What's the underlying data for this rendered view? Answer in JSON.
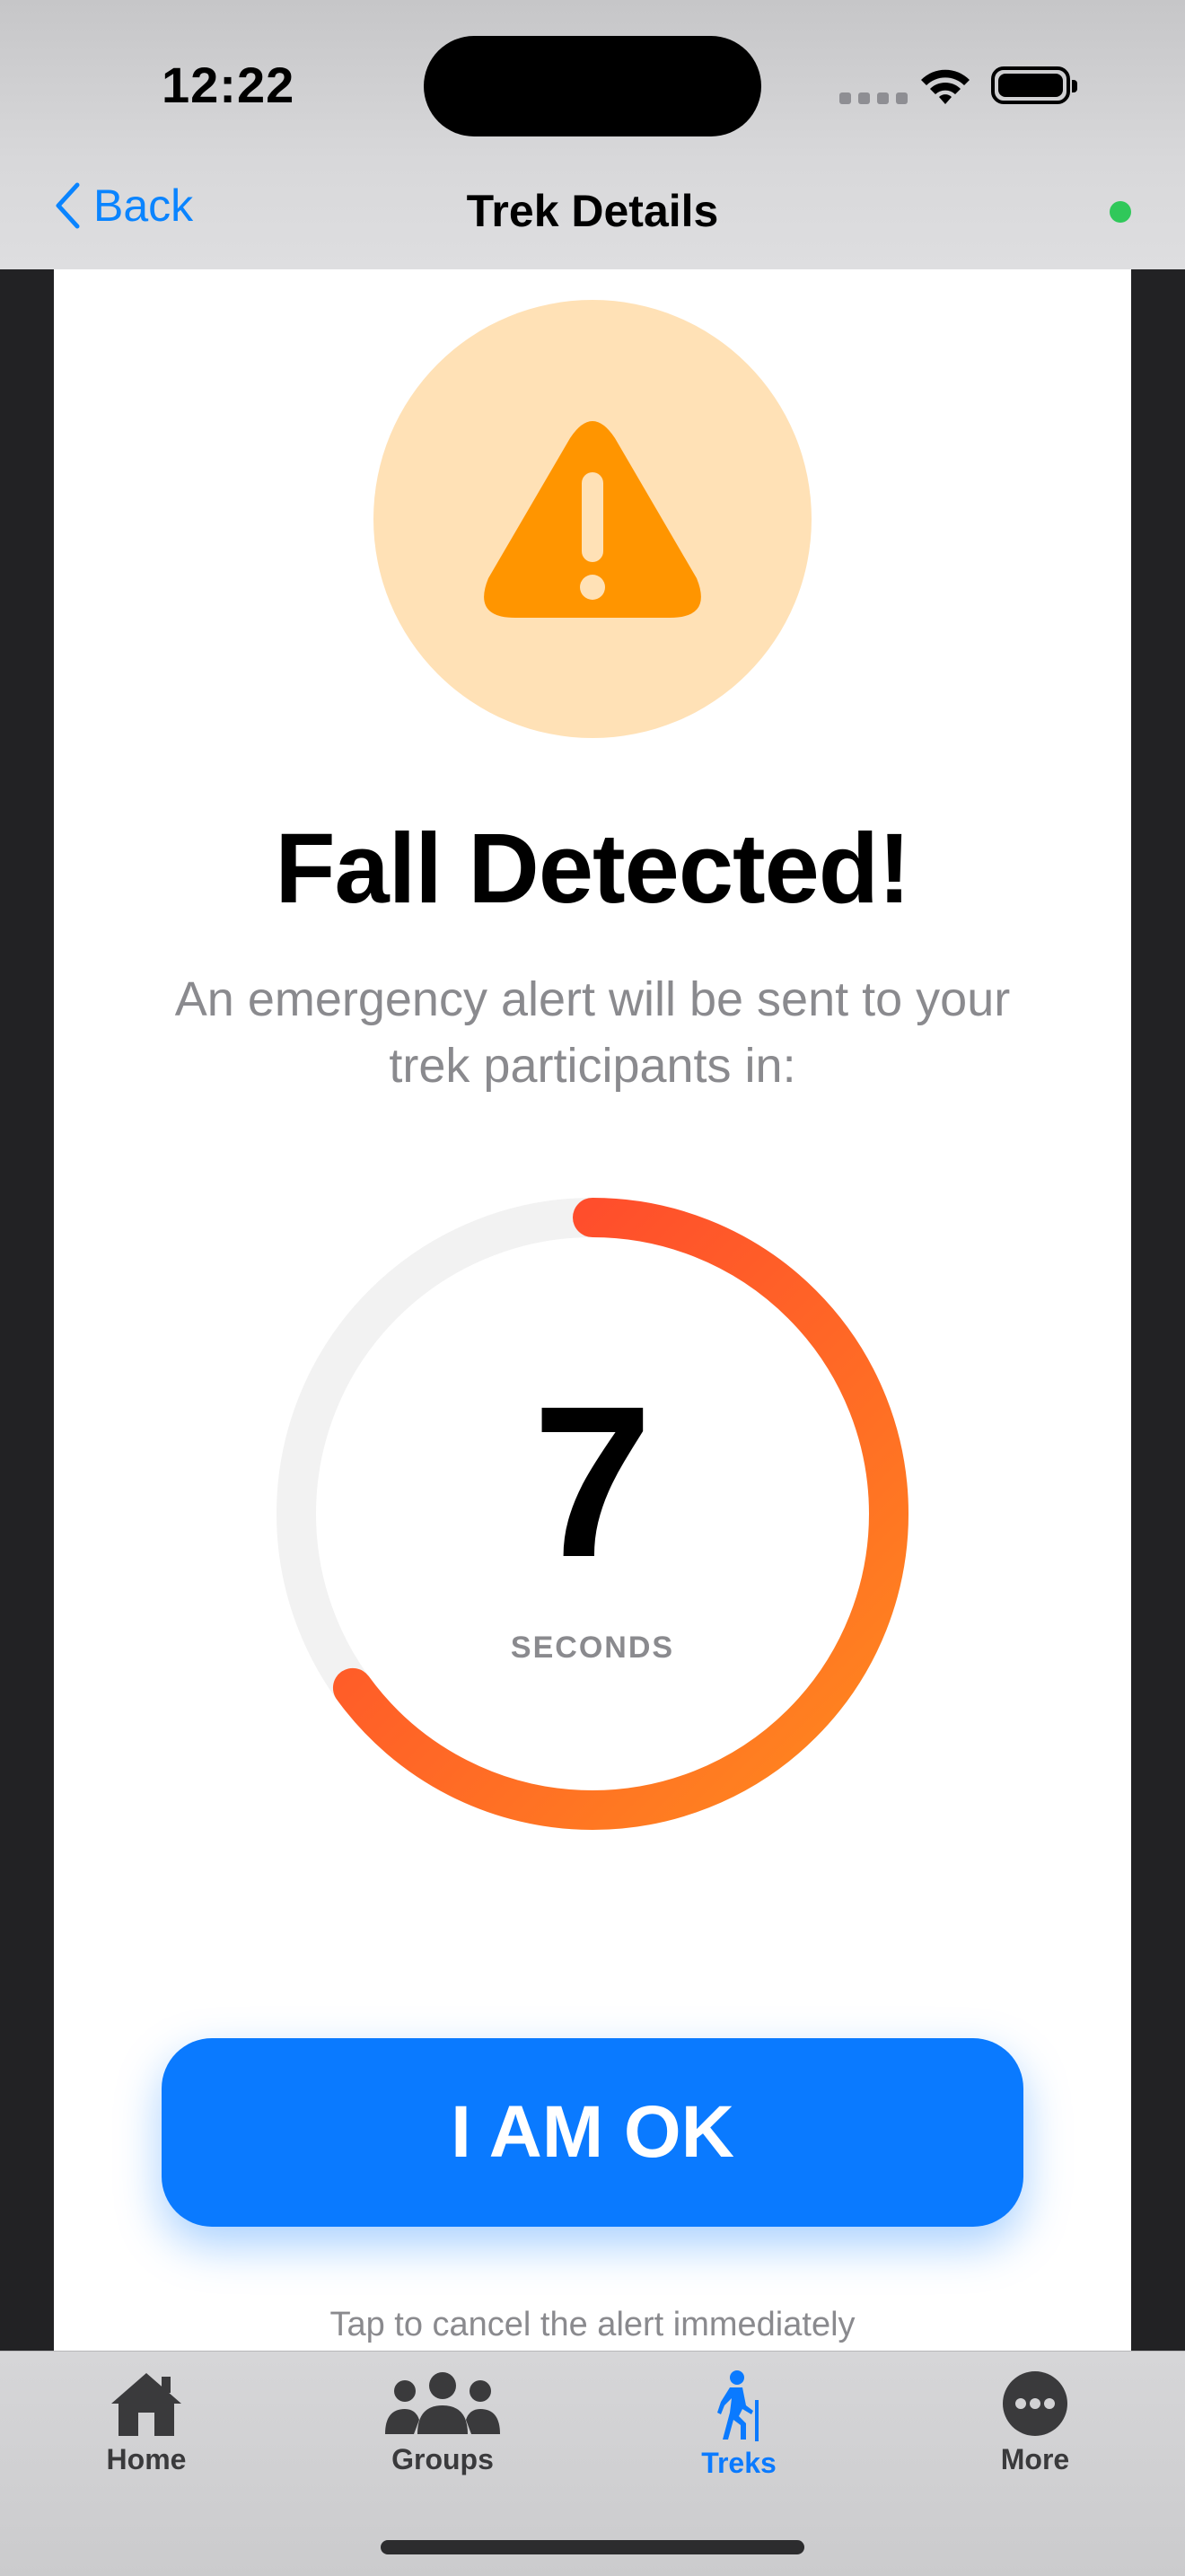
{
  "status_bar": {
    "time": "12:22"
  },
  "nav": {
    "back_label": "Back",
    "title": "Trek Details",
    "status_color": "#30c85a"
  },
  "alert": {
    "icon": "warning-triangle-icon",
    "title": "Fall Detected!",
    "subtitle": "An emergency alert will be sent to your trek participants in:",
    "countdown_value": "7",
    "countdown_unit": "SECONDS",
    "countdown_progress": 0.65,
    "primary_button": "I AM OK",
    "hint": "Tap to cancel the alert immediately"
  },
  "tabbar": {
    "items": [
      {
        "label": "Home",
        "icon": "house-icon"
      },
      {
        "label": "Groups",
        "icon": "people-icon"
      },
      {
        "label": "Treks",
        "icon": "hiker-icon",
        "active": true
      },
      {
        "label": "More",
        "icon": "ellipsis-circle-icon"
      }
    ]
  },
  "colors": {
    "accent": "#0a7aff",
    "warning": "#ff9500",
    "ring_start": "#ff8a1e",
    "ring_end": "#ff3b30"
  }
}
